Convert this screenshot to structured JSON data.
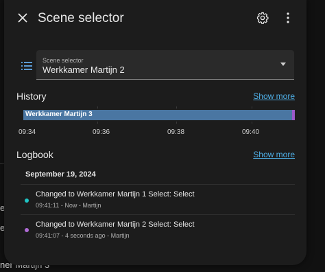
{
  "background": {
    "fragment_text": "ner Martijn 3",
    "fragment_letter": "e"
  },
  "dialog": {
    "title": "Scene selector",
    "close_icon": "close-icon",
    "settings_icon": "gear-icon",
    "more_icon": "more-vert-icon"
  },
  "select": {
    "icon": "list-icon",
    "label": "Scene selector",
    "value": "Werkkamer Martijn 2"
  },
  "history": {
    "title": "History",
    "show_more": "Show more",
    "bar_label": "Werkkamer Martijn 3",
    "bar_color": "#4a76a2",
    "bar_end_color": "#9b59c8",
    "ticks": [
      "09:34",
      "09:36",
      "09:38",
      "09:40"
    ]
  },
  "logbook": {
    "title": "Logbook",
    "show_more": "Show more",
    "date": "September 19, 2024",
    "entries": [
      {
        "title": "Changed to Werkkamer Martijn 1 Select: Select",
        "meta": "09:41:11 - Now - Martijn",
        "dot_color": "#1fc4c4"
      },
      {
        "title": "Changed to Werkkamer Martijn 2 Select: Select",
        "meta": "09:41:07 - 4 seconds ago - Martijn",
        "dot_color": "#b06bd6"
      }
    ]
  },
  "colors": {
    "accent_link": "#4fb0e8",
    "dialog_bg": "#1c1c1c"
  }
}
